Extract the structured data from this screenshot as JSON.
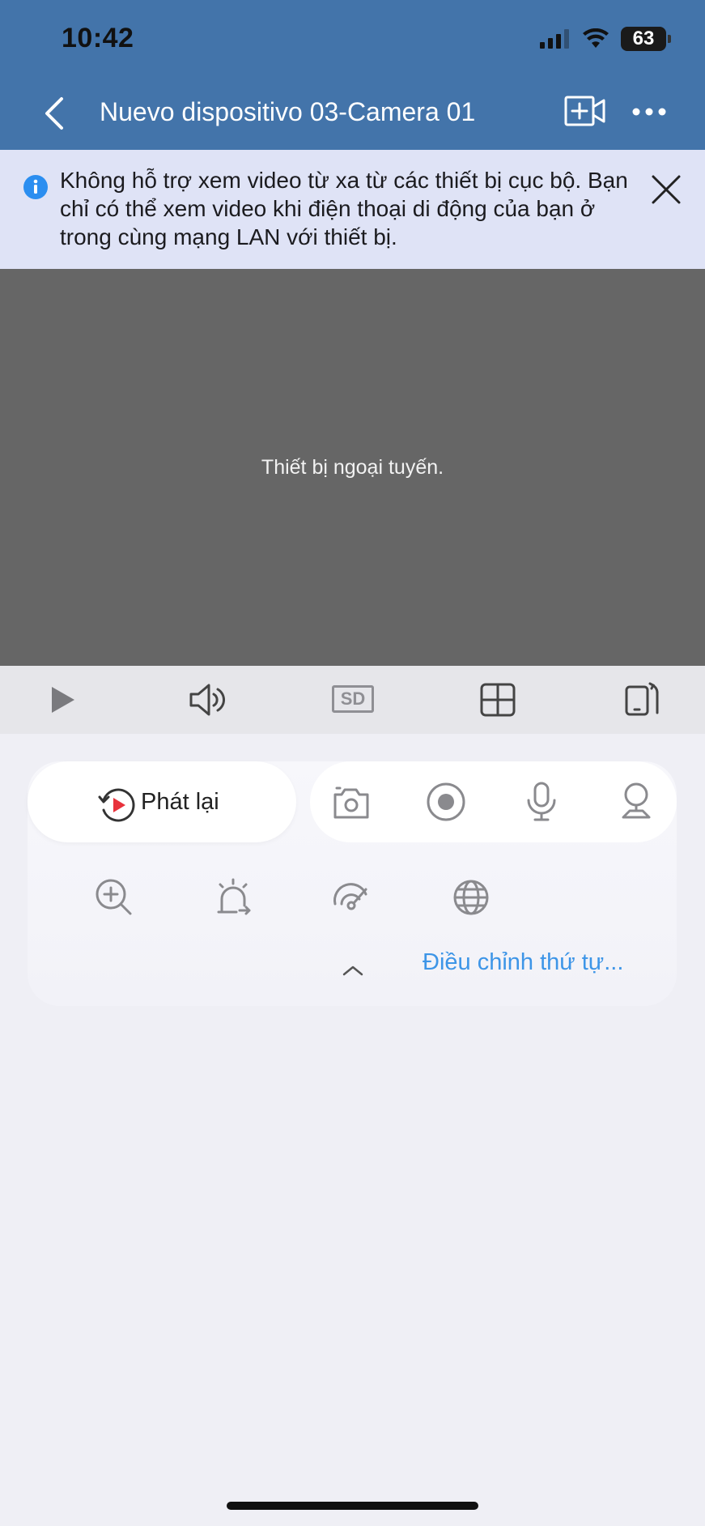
{
  "status_bar": {
    "time": "10:42",
    "battery": "63",
    "icons": [
      "signal-icon",
      "wifi-icon",
      "battery-icon"
    ]
  },
  "nav": {
    "title": "Nuevo dispositivo 03-Camera 01",
    "back_icon": "chevron-left-icon",
    "add_camera_icon": "add-camera-icon",
    "more_icon": "more-icon"
  },
  "banner": {
    "text": "Không hỗ trợ xem video từ xa từ các thiết bị cục bộ. Bạn chỉ có thể xem video khi điện thoại di động của bạn ở trong cùng mạng LAN với thiết bị.",
    "info_icon": "info-icon",
    "close_icon": "close-icon"
  },
  "video": {
    "message": "Thiết bị ngoại tuyến."
  },
  "toolbar": {
    "icons": [
      "play-icon",
      "speaker-icon",
      "sd-quality-icon",
      "grid-layout-icon",
      "rotate-screen-icon"
    ],
    "quality_label": "SD"
  },
  "controls": {
    "playback_label": "Phát lại",
    "action_icons": [
      "camera-snapshot-icon",
      "record-icon",
      "microphone-icon",
      "ptz-camera-icon"
    ],
    "extra_icons": [
      "zoom-in-icon",
      "alarm-icon",
      "speed-gauge-icon",
      "globe-icon"
    ],
    "adjust_order_label": "Điều chỉnh thứ tự..."
  },
  "colors": {
    "header": "#4374aa",
    "banner": "#dfe3f6",
    "video_bg": "#666666",
    "link": "#3d95e7",
    "playback_red": "#e8323c"
  }
}
